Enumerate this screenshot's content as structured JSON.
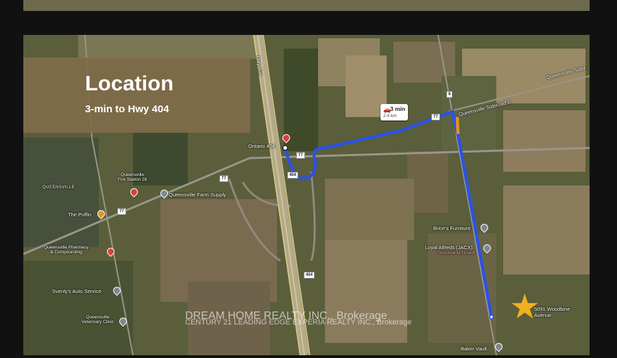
{
  "location_box": {
    "title": "Location",
    "subtitle": "3-min to Hwy 404"
  },
  "route_badge": {
    "time": "3 min",
    "distance": "2.4 km"
  },
  "labels": {
    "ontario_404": "Ontario 404",
    "queensville": "QUEENSVILLE",
    "fire_station": "Queensville\nFire Station 28",
    "farm_supply": "Queensville Farm Supply",
    "the_puffin": "The Puffin",
    "pharmacy": "Queensville Pharmacy\n& Compounding",
    "svenly": "Svenly's Auto Service",
    "vet": "Queensville\nVeterinary Clinic",
    "brice": "Brice's Furniture",
    "loyal": "Loyal Alfreds (JACX)",
    "loyal_status": "Temporarily closed",
    "baker": "Baker Vault",
    "sideroad_e": "Queensville Sideroad E",
    "sideroad_e2": "Queensville Sider",
    "woodbine": "5091 Woodbine\nAvenue",
    "hwy_404_vertical": "Hwy 404"
  },
  "shields": {
    "r77_a": "77",
    "r77_b": "77",
    "r77_c": "77",
    "r77_d": "77",
    "r404_a": "404",
    "r404_b": "404",
    "r8": "8"
  },
  "watermark": {
    "line1": "DREAM HOME REALTY INC., Brokerage",
    "line2": "CENTURY 21 LEADING EDGE EXPERIA REALTY INC., Brokerage"
  },
  "colors": {
    "route": "#2a52e8",
    "route_segment": "#e8921f",
    "location_box": "#806c4a",
    "star": "#f2b01e"
  }
}
